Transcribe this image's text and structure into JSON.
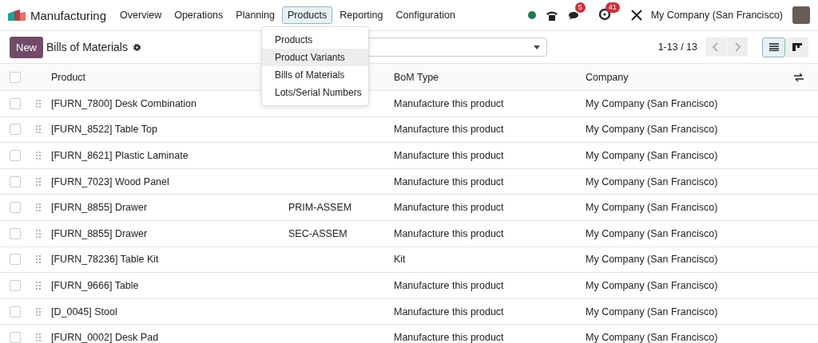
{
  "app": {
    "name": "Manufacturing"
  },
  "menu": [
    {
      "label": "Overview",
      "selected": false
    },
    {
      "label": "Operations",
      "selected": false
    },
    {
      "label": "Planning",
      "selected": false
    },
    {
      "label": "Products",
      "selected": true
    },
    {
      "label": "Reporting",
      "selected": false
    },
    {
      "label": "Configuration",
      "selected": false
    }
  ],
  "dropdown": [
    {
      "label": "Products",
      "selected": false
    },
    {
      "label": "Product Variants",
      "selected": true
    },
    {
      "label": "Bills of Materials",
      "selected": false
    },
    {
      "label": "Lots/Serial Numbers",
      "selected": false
    }
  ],
  "systray": {
    "messages_badge": "5",
    "activities_badge": "41",
    "company": "My Company (San Francisco)"
  },
  "control": {
    "new_button": "New",
    "title": "Bills of Materials",
    "pager": "1-13 / 13",
    "views": [
      {
        "kind": "list",
        "selected": true
      },
      {
        "kind": "kanban",
        "selected": false
      }
    ]
  },
  "table": {
    "select_all_checked": false,
    "columns": [
      "Product",
      "BoM Type",
      "Company"
    ],
    "rows": [
      {
        "product": "[FURN_7800] Desk Combination",
        "bom_type": "Manufacture this product",
        "company": "My Company (San Francisco)",
        "checked": false
      },
      {
        "product": "[FURN_8522] Table Top",
        "bom_type": "Manufacture this product",
        "company": "My Company (San Francisco)",
        "checked": false
      },
      {
        "product": "[FURN_8621] Plastic Laminate",
        "bom_type": "Manufacture this product",
        "company": "My Company (San Francisco)",
        "checked": false
      },
      {
        "product": "[FURN_7023] Wood Panel",
        "bom_type": "Manufacture this product",
        "company": "My Company (San Francisco)",
        "checked": false
      },
      {
        "product": "[FURN_8855] Drawer",
        "reference": "PRIM-ASSEM",
        "bom_type": "Manufacture this product",
        "company": "My Company (San Francisco)",
        "checked": false
      },
      {
        "product": "[FURN_8855] Drawer",
        "reference": "SEC-ASSEM",
        "bom_type": "Manufacture this product",
        "company": "My Company (San Francisco)",
        "checked": false
      },
      {
        "product": "[FURN_78236] Table Kit",
        "bom_type": "Kit",
        "company": "My Company (San Francisco)",
        "checked": false
      },
      {
        "product": "[FURN_9666] Table",
        "bom_type": "Manufacture this product",
        "company": "My Company (San Francisco)",
        "checked": false
      },
      {
        "product": "[D_0045] Stool",
        "bom_type": "Manufacture this product",
        "company": "My Company (San Francisco)",
        "checked": false
      },
      {
        "product": "[FURN_0002] Desk Pad",
        "bom_type": "Manufacture this product",
        "company": "My Company (San Francisco)",
        "checked": false
      }
    ]
  }
}
